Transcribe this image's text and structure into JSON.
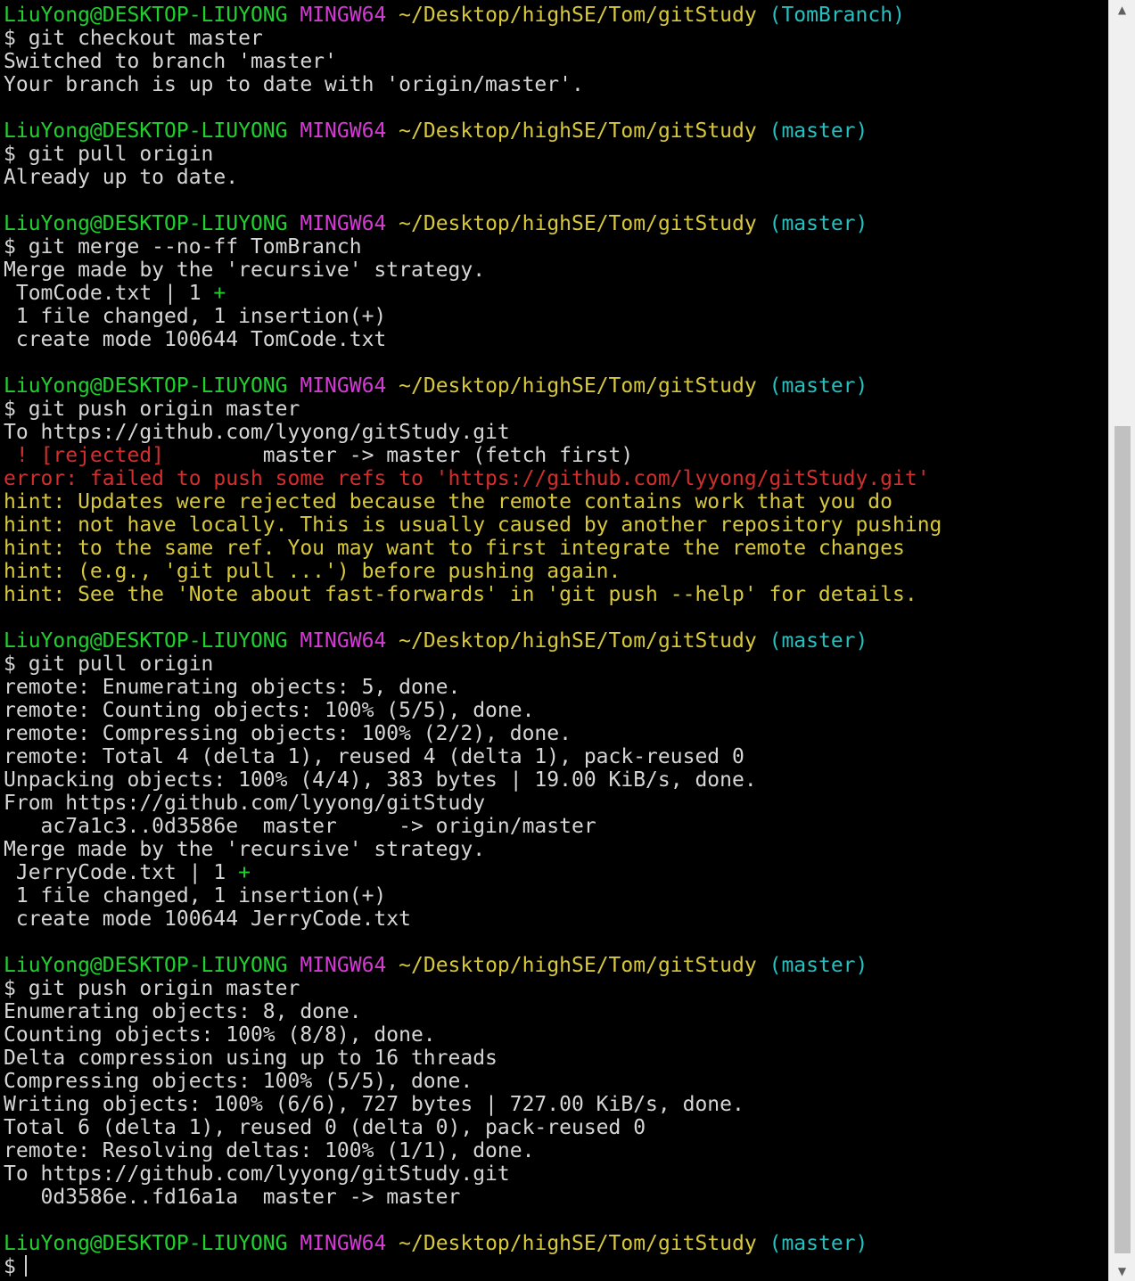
{
  "colors": {
    "user_host": "#1fd12f",
    "shell": "#d43ad4",
    "path": "#d7c83c",
    "branch": "#27bfbf",
    "text": "#e6e6e6",
    "error": "#d42d2d",
    "hint": "#d7c83c"
  },
  "scrollbar": {
    "up_icon": "chevron-up-icon",
    "down_icon": "chevron-down-icon",
    "up_glyph": "▲",
    "down_glyph": "▼"
  },
  "lines": [
    [
      {
        "t": "LiuYong@DESKTOP-LIUYONG",
        "c": "green"
      },
      {
        "t": " "
      },
      {
        "t": "MINGW64",
        "c": "magenta"
      },
      {
        "t": " "
      },
      {
        "t": "~/Desktop/highSE/Tom/gitStudy",
        "c": "yellow"
      },
      {
        "t": " "
      },
      {
        "t": "(TomBranch)",
        "c": "cyan"
      }
    ],
    [
      {
        "t": "$ git checkout master"
      }
    ],
    [
      {
        "t": "Switched to branch 'master'"
      }
    ],
    [
      {
        "t": "Your branch is up to date with 'origin/master'."
      }
    ],
    [
      {
        "t": ""
      }
    ],
    [
      {
        "t": "LiuYong@DESKTOP-LIUYONG",
        "c": "green"
      },
      {
        "t": " "
      },
      {
        "t": "MINGW64",
        "c": "magenta"
      },
      {
        "t": " "
      },
      {
        "t": "~/Desktop/highSE/Tom/gitStudy",
        "c": "yellow"
      },
      {
        "t": " "
      },
      {
        "t": "(master)",
        "c": "cyan"
      }
    ],
    [
      {
        "t": "$ git pull origin"
      }
    ],
    [
      {
        "t": "Already up to date."
      }
    ],
    [
      {
        "t": ""
      }
    ],
    [
      {
        "t": "LiuYong@DESKTOP-LIUYONG",
        "c": "green"
      },
      {
        "t": " "
      },
      {
        "t": "MINGW64",
        "c": "magenta"
      },
      {
        "t": " "
      },
      {
        "t": "~/Desktop/highSE/Tom/gitStudy",
        "c": "yellow"
      },
      {
        "t": " "
      },
      {
        "t": "(master)",
        "c": "cyan"
      }
    ],
    [
      {
        "t": "$ git merge --no-ff TomBranch"
      }
    ],
    [
      {
        "t": "Merge made by the 'recursive' strategy."
      }
    ],
    [
      {
        "t": " TomCode.txt | 1 "
      },
      {
        "t": "+",
        "c": "green"
      }
    ],
    [
      {
        "t": " 1 file changed, 1 insertion(+)"
      }
    ],
    [
      {
        "t": " create mode 100644 TomCode.txt"
      }
    ],
    [
      {
        "t": ""
      }
    ],
    [
      {
        "t": "LiuYong@DESKTOP-LIUYONG",
        "c": "green"
      },
      {
        "t": " "
      },
      {
        "t": "MINGW64",
        "c": "magenta"
      },
      {
        "t": " "
      },
      {
        "t": "~/Desktop/highSE/Tom/gitStudy",
        "c": "yellow"
      },
      {
        "t": " "
      },
      {
        "t": "(master)",
        "c": "cyan"
      }
    ],
    [
      {
        "t": "$ git push origin master"
      }
    ],
    [
      {
        "t": "To https://github.com/lyyong/gitStudy.git"
      }
    ],
    [
      {
        "t": " ! [rejected]",
        "c": "red"
      },
      {
        "t": "        master -> master (fetch first)"
      }
    ],
    [
      {
        "t": "error: failed to push some refs to 'https://github.com/lyyong/gitStudy.git'",
        "c": "red"
      }
    ],
    [
      {
        "t": "hint: Updates were rejected because the remote contains work that you do",
        "c": "hint"
      }
    ],
    [
      {
        "t": "hint: not have locally. This is usually caused by another repository pushing",
        "c": "hint"
      }
    ],
    [
      {
        "t": "hint: to the same ref. You may want to first integrate the remote changes",
        "c": "hint"
      }
    ],
    [
      {
        "t": "hint: (e.g., 'git pull ...') before pushing again.",
        "c": "hint"
      }
    ],
    [
      {
        "t": "hint: See the 'Note about fast-forwards' in 'git push --help' for details.",
        "c": "hint"
      }
    ],
    [
      {
        "t": ""
      }
    ],
    [
      {
        "t": "LiuYong@DESKTOP-LIUYONG",
        "c": "green"
      },
      {
        "t": " "
      },
      {
        "t": "MINGW64",
        "c": "magenta"
      },
      {
        "t": " "
      },
      {
        "t": "~/Desktop/highSE/Tom/gitStudy",
        "c": "yellow"
      },
      {
        "t": " "
      },
      {
        "t": "(master)",
        "c": "cyan"
      }
    ],
    [
      {
        "t": "$ git pull origin"
      }
    ],
    [
      {
        "t": "remote: Enumerating objects: 5, done."
      }
    ],
    [
      {
        "t": "remote: Counting objects: 100% (5/5), done."
      }
    ],
    [
      {
        "t": "remote: Compressing objects: 100% (2/2), done."
      }
    ],
    [
      {
        "t": "remote: Total 4 (delta 1), reused 4 (delta 1), pack-reused 0"
      }
    ],
    [
      {
        "t": "Unpacking objects: 100% (4/4), 383 bytes | 19.00 KiB/s, done."
      }
    ],
    [
      {
        "t": "From https://github.com/lyyong/gitStudy"
      }
    ],
    [
      {
        "t": "   ac7a1c3..0d3586e  master     -> origin/master"
      }
    ],
    [
      {
        "t": "Merge made by the 'recursive' strategy."
      }
    ],
    [
      {
        "t": " JerryCode.txt | 1 "
      },
      {
        "t": "+",
        "c": "green"
      }
    ],
    [
      {
        "t": " 1 file changed, 1 insertion(+)"
      }
    ],
    [
      {
        "t": " create mode 100644 JerryCode.txt"
      }
    ],
    [
      {
        "t": ""
      }
    ],
    [
      {
        "t": "LiuYong@DESKTOP-LIUYONG",
        "c": "green"
      },
      {
        "t": " "
      },
      {
        "t": "MINGW64",
        "c": "magenta"
      },
      {
        "t": " "
      },
      {
        "t": "~/Desktop/highSE/Tom/gitStudy",
        "c": "yellow"
      },
      {
        "t": " "
      },
      {
        "t": "(master)",
        "c": "cyan"
      }
    ],
    [
      {
        "t": "$ git push origin master"
      }
    ],
    [
      {
        "t": "Enumerating objects: 8, done."
      }
    ],
    [
      {
        "t": "Counting objects: 100% (8/8), done."
      }
    ],
    [
      {
        "t": "Delta compression using up to 16 threads"
      }
    ],
    [
      {
        "t": "Compressing objects: 100% (5/5), done."
      }
    ],
    [
      {
        "t": "Writing objects: 100% (6/6), 727 bytes | 727.00 KiB/s, done."
      }
    ],
    [
      {
        "t": "Total 6 (delta 1), reused 0 (delta 0), pack-reused 0"
      }
    ],
    [
      {
        "t": "remote: Resolving deltas: 100% (1/1), done."
      }
    ],
    [
      {
        "t": "To https://github.com/lyyong/gitStudy.git"
      }
    ],
    [
      {
        "t": "   0d3586e..fd16a1a  master -> master"
      }
    ],
    [
      {
        "t": ""
      }
    ],
    [
      {
        "t": "LiuYong@DESKTOP-LIUYONG",
        "c": "green"
      },
      {
        "t": " "
      },
      {
        "t": "MINGW64",
        "c": "magenta"
      },
      {
        "t": " "
      },
      {
        "t": "~/Desktop/highSE/Tom/gitStudy",
        "c": "yellow"
      },
      {
        "t": " "
      },
      {
        "t": "(master)",
        "c": "cyan"
      }
    ],
    [
      {
        "t": "$"
      }
    ]
  ]
}
